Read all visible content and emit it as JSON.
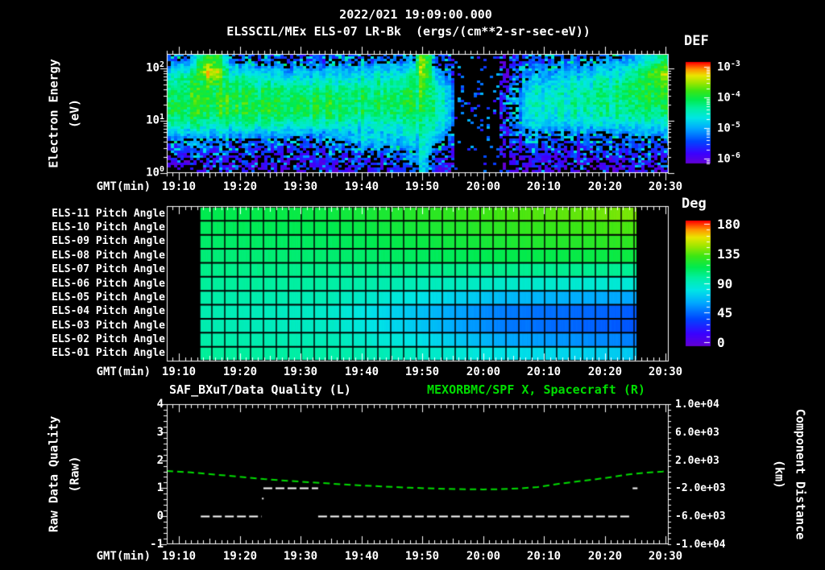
{
  "colors": {
    "background": "#000000",
    "foreground": "#ffffff",
    "green": "#00dd00",
    "frame": "#ffffff"
  },
  "header": {
    "line1": "2022/021 19:09:00.000",
    "line2": "ELSSCIL/MEx ELS-07 LR-Bk  (ergs/(cm**2-sr-sec-eV))"
  },
  "time_axis": {
    "label": "GMT(min)",
    "tick_labels": [
      "19:10",
      "19:20",
      "19:30",
      "19:40",
      "19:50",
      "20:00",
      "20:10",
      "20:20",
      "20:30"
    ],
    "tick_minutes": [
      0,
      10,
      20,
      30,
      40,
      50,
      60,
      70,
      80
    ],
    "minor_step_min": 1,
    "range_min": [
      -2.0,
      80.5
    ]
  },
  "chart_data": [
    {
      "type": "heatmap",
      "name": "electron-energy-spectrogram",
      "ylabel": "Electron Energy\n(eV)",
      "y_scale": "log",
      "y_ticks": [
        {
          "base": "10",
          "exp": "2",
          "value_log10": 2
        },
        {
          "base": "10",
          "exp": "1",
          "value_log10": 1
        },
        {
          "base": "10",
          "exp": "0",
          "value_log10": 0
        }
      ],
      "colorbar": {
        "label": "DEF",
        "units": "ergs/(cm**2-sr-sec-eV)",
        "ticks": [
          {
            "base": "10",
            "exp": "-3",
            "value_log10": -3
          },
          {
            "base": "10",
            "exp": "-4",
            "value_log10": -4
          },
          {
            "base": "10",
            "exp": "-5",
            "value_log10": -5
          },
          {
            "base": "10",
            "exp": "-6",
            "value_log10": -6
          }
        ],
        "range_log10": [
          -6.3,
          -2.9
        ]
      },
      "t_cols_min": [
        -2,
        3,
        8,
        13,
        18,
        23,
        28,
        33,
        38,
        43,
        48,
        53,
        58,
        63,
        68,
        73,
        78,
        80.5
      ],
      "values_log10def": [
        [
          -5.5,
          -5.1,
          -5.3,
          -5.5,
          -5.6,
          -5.6,
          -5.5,
          -5.4,
          -5.3,
          -5.5,
          -6.2,
          -6.2,
          -5.6,
          -5.5,
          -5.4,
          -5.2,
          -5.0,
          -5.0
        ],
        [
          -5.0,
          -4.4,
          -4.7,
          -5.0,
          -5.1,
          -5.1,
          -5.0,
          -4.9,
          -4.8,
          -5.1,
          -6.2,
          -6.2,
          -5.3,
          -5.1,
          -5.0,
          -4.8,
          -4.2,
          -4.0
        ],
        [
          -4.5,
          -4.1,
          -4.3,
          -4.5,
          -4.6,
          -4.7,
          -4.6,
          -4.5,
          -4.4,
          -4.8,
          -6.1,
          -6.1,
          -5.0,
          -4.8,
          -4.6,
          -4.4,
          -3.9,
          -3.8
        ],
        [
          -4.2,
          -4.0,
          -4.1,
          -4.2,
          -4.2,
          -4.3,
          -4.3,
          -4.3,
          -4.2,
          -4.5,
          -6.1,
          -6.0,
          -4.8,
          -4.6,
          -4.5,
          -4.3,
          -4.0,
          -3.9
        ],
        [
          -4.1,
          -4.0,
          -4.0,
          -4.1,
          -4.1,
          -4.1,
          -4.2,
          -4.2,
          -4.1,
          -4.4,
          -6.0,
          -5.9,
          -4.6,
          -4.5,
          -4.4,
          -4.3,
          -4.1,
          -4.0
        ],
        [
          -4.1,
          -4.1,
          -4.1,
          -4.1,
          -4.1,
          -4.2,
          -4.3,
          -4.3,
          -4.2,
          -4.4,
          -6.0,
          -5.9,
          -4.7,
          -4.6,
          -4.5,
          -4.4,
          -4.3,
          -4.2
        ],
        [
          -4.4,
          -4.4,
          -4.5,
          -4.5,
          -4.5,
          -4.6,
          -4.6,
          -4.6,
          -4.5,
          -4.6,
          -6.0,
          -5.9,
          -4.9,
          -4.9,
          -4.8,
          -4.8,
          -4.7,
          -4.7
        ],
        [
          -5.0,
          -5.0,
          -5.1,
          -5.1,
          -5.1,
          -5.2,
          -5.0,
          -4.9,
          -4.7,
          -4.9,
          -6.1,
          -6.0,
          -5.3,
          -5.4,
          -5.4,
          -5.3,
          -5.2,
          -5.2
        ],
        [
          -5.5,
          -5.5,
          -5.5,
          -5.6,
          -5.6,
          -5.6,
          -5.4,
          -5.3,
          -5.1,
          -5.3,
          -6.3,
          -6.2,
          -5.6,
          -5.7,
          -5.7,
          -5.6,
          -5.5,
          -5.5
        ],
        [
          -5.8,
          -5.8,
          -5.8,
          -5.9,
          -5.9,
          -5.9,
          -5.7,
          -5.6,
          -5.4,
          -5.6,
          -6.5,
          -6.4,
          -5.8,
          -5.9,
          -5.9,
          -5.8,
          -5.8,
          -5.8
        ],
        [
          -6.0,
          -6.0,
          -6.0,
          -6.1,
          -6.1,
          -6.1,
          -5.9,
          -5.8,
          -5.7,
          -5.8,
          -6.6,
          -6.5,
          -6.0,
          -6.1,
          -6.1,
          -6.0,
          -6.0,
          -6.0
        ]
      ],
      "features": [
        {
          "kind": "blob",
          "t0": 2.5,
          "t1": 8,
          "peak_row": 1.2,
          "peak": -3.25,
          "row_falloff": 0.5,
          "shape": "pulse",
          "soften": 1.2,
          "note": "bright orange burst ~19:14, 30-120 eV"
        },
        {
          "kind": "blob",
          "t0": 38.8,
          "t1": 41.6,
          "peak_row": 1.0,
          "peak": -3.55,
          "row_falloff": 0.14,
          "shape": "pulse",
          "soften": 0.8,
          "note": "bright vertical streak ~19:50"
        },
        {
          "kind": "blob",
          "t0": 73,
          "t1": 80.5,
          "peak_row": 1.4,
          "peak": -3.35,
          "row_falloff": 0.55,
          "shape": "ramp",
          "soften": 1.3,
          "note": "bright patch 20:23-20:31, 20-100 eV"
        },
        {
          "kind": "blob",
          "t0": 26,
          "t1": 38,
          "peak_row": 7.2,
          "peak": -4.7,
          "row_falloff": 0.5,
          "shape": "pulse",
          "soften": 0.5,
          "note": "cyan streaks below band 19:36-19:48"
        },
        {
          "kind": "gap",
          "t0": 45.3,
          "t1": 52.6,
          "note": "black data gap ~19:55-20:02"
        }
      ]
    },
    {
      "type": "heatmap",
      "name": "pitch-angle-panel",
      "row_labels": [
        "ELS-11 Pitch Angle",
        "ELS-10 Pitch Angle",
        "ELS-09 Pitch Angle",
        "ELS-08 Pitch Angle",
        "ELS-07 Pitch Angle",
        "ELS-06 Pitch Angle",
        "ELS-05 Pitch Angle",
        "ELS-04 Pitch Angle",
        "ELS-03 Pitch Angle",
        "ELS-02 Pitch Angle",
        "ELS-01 Pitch Angle"
      ],
      "colorbar": {
        "label": "Deg",
        "ticks": [
          180,
          135,
          90,
          45,
          0
        ],
        "range": [
          0,
          180
        ],
        "minor_step": 9
      },
      "data_time_range_min": [
        3.5,
        75.3
      ],
      "keyframes_fraction": [
        0,
        0.3,
        0.5,
        0.7,
        1
      ],
      "rows_deg": [
        [
          113,
          117,
          124,
          131,
          139
        ],
        [
          111,
          114,
          120,
          126,
          132
        ],
        [
          109,
          111,
          116,
          121,
          126
        ],
        [
          106,
          108,
          111,
          114,
          117
        ],
        [
          103,
          103,
          103,
          102,
          101
        ],
        [
          100,
          98,
          93,
          88,
          85
        ],
        [
          97,
          93,
          81,
          68,
          62
        ],
        [
          95,
          88,
          70,
          52,
          45
        ],
        [
          95,
          89,
          72,
          52,
          43
        ],
        [
          97,
          93,
          80,
          63,
          53
        ],
        [
          100,
          97,
          90,
          80,
          72
        ]
      ],
      "grid_cell_min": 2.1
    },
    {
      "type": "line",
      "name": "quality-and-distance-panel",
      "title_left": "SAF_BXuT/Data Quality (L)",
      "title_right": "MEXORBMC/SPF X, Spacecraft (R)",
      "left_axis": {
        "label": "Raw Data Quality\n(Raw)",
        "ticks": [
          4,
          3,
          2,
          1,
          0,
          -1
        ],
        "range": [
          -1,
          4
        ],
        "minor_step": 0.2
      },
      "right_axis": {
        "label": "Component Distance\n(km)",
        "tick_labels": [
          "1.0e+04",
          "6.0e+03",
          "2.0e+03",
          "-2.0e+03",
          "-6.0e+03",
          "-1.0e+04"
        ],
        "tick_values": [
          10000,
          6000,
          2000,
          -2000,
          -6000,
          -10000
        ],
        "range": [
          -10000,
          10000
        ],
        "minor_step": 800
      },
      "series": [
        {
          "name": "SAF_BXuT/Data Quality",
          "axis": "left",
          "color": "#ffffff",
          "style": "dashed",
          "segments": [
            {
              "value": 0,
              "t0": 3.6,
              "t1": 13.6
            },
            {
              "value": 1,
              "t0": 13.9,
              "t1": 22.9
            },
            {
              "value": 0,
              "t0": 22.9,
              "t1": 74.3
            },
            {
              "value": 1,
              "t0": 74.6,
              "t1": 75.4
            }
          ],
          "points": [
            {
              "t": 13.8,
              "value": 0.63
            }
          ]
        },
        {
          "name": "MEXORBMC/SPF X, Spacecraft",
          "axis": "right",
          "color": "#00dd00",
          "style": "dashed",
          "points_t_km": [
            [
              -2,
              460
            ],
            [
              2,
              250
            ],
            [
              6,
              -60
            ],
            [
              10,
              -360
            ],
            [
              14,
              -700
            ],
            [
              18,
              -950
            ],
            [
              22,
              -1180
            ],
            [
              26,
              -1400
            ],
            [
              30,
              -1600
            ],
            [
              34,
              -1780
            ],
            [
              38,
              -1930
            ],
            [
              42,
              -2050
            ],
            [
              46,
              -2130
            ],
            [
              50,
              -2170
            ],
            [
              53,
              -2140
            ],
            [
              56,
              -2040
            ],
            [
              59,
              -1830
            ],
            [
              62,
              -1430
            ],
            [
              65,
              -1100
            ],
            [
              68,
              -780
            ],
            [
              71,
              -430
            ],
            [
              74,
              -30
            ],
            [
              77,
              230
            ],
            [
              79.5,
              380
            ],
            [
              80.5,
              470
            ]
          ]
        }
      ]
    }
  ]
}
